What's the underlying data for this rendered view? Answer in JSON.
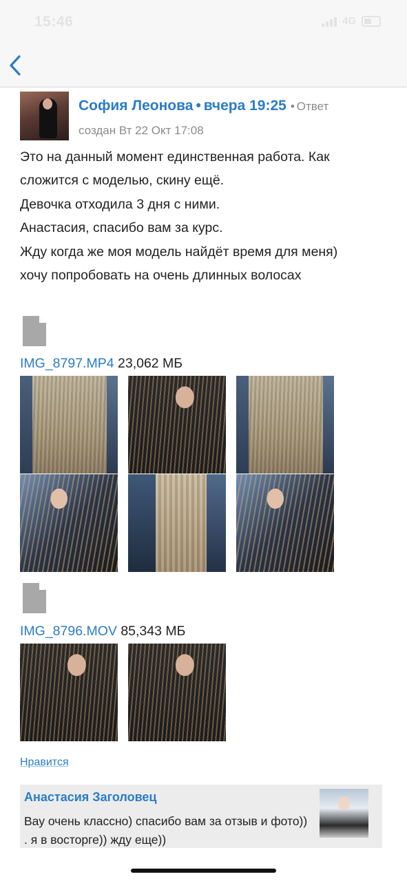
{
  "status": {
    "time": "15:46",
    "network": "4G"
  },
  "post": {
    "author": "София Леонова",
    "separator": "•",
    "time": "вчера 19:25",
    "reply_label": "Ответ",
    "created": "создан Вт 22 Окт 17:08",
    "lines": [
      "Это на данный момент единственная работа. Как",
      "сложится с моделью, скину ещё.",
      "Девочка отходила 3 дня с ними.",
      "Анастасия, спасибо вам за курс.",
      "Жду когда же моя модель найдёт время для меня)",
      "хочу попробовать на очень длинных волосах"
    ],
    "attachments": [
      {
        "name": "IMG_8797.MP4",
        "size": "23,062 МБ"
      },
      {
        "name": "IMG_8796.MOV",
        "size": "85,343 МБ"
      }
    ],
    "like_label": "Нравится"
  },
  "reply": {
    "author": "Анастасия Заголовец",
    "text": "Вау очень классно) спасибо вам за отзыв и фото)) . я в восторге)) жду еще))"
  },
  "colors": {
    "link": "#2a7cc7",
    "muted": "#8a8a8a",
    "file_icon": "#a8a8a8",
    "reply_bg": "#ececec"
  }
}
